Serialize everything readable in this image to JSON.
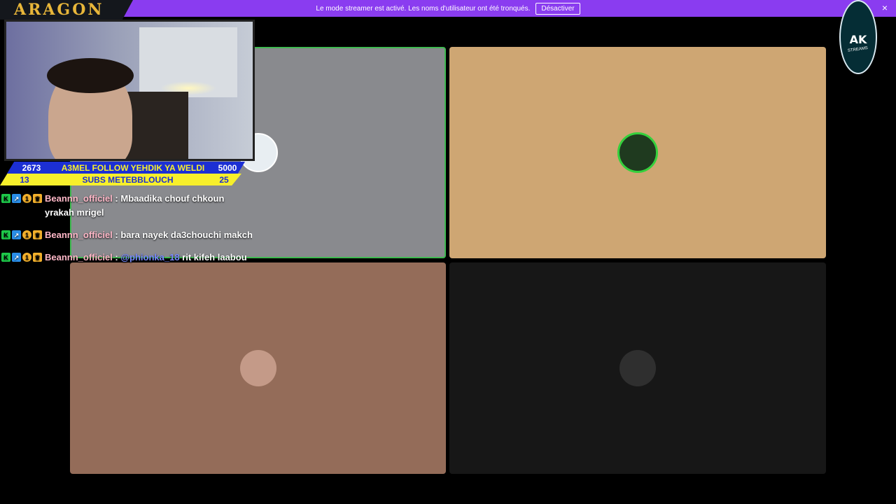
{
  "banner": {
    "message": "Le mode streamer est activé. Les noms d'utilisateur ont été tronqués.",
    "button_label": "Désactiver",
    "close_glyph": "×"
  },
  "logo": {
    "text": "ARAGON"
  },
  "ak_badge": {
    "text": "AK",
    "subtext": "STREAMS"
  },
  "tiles": [
    {
      "bg": "#898a8e",
      "speaking": true,
      "avatar_color": "#e8eef2"
    },
    {
      "bg": "#cea673",
      "speaking": false,
      "avatar_color": "#1f3a1f"
    },
    {
      "bg": "#946c59",
      "speaking": false,
      "avatar_color": "#c49a88"
    },
    {
      "bg": "#171717",
      "speaking": false,
      "avatar_color": "#2f2f2f"
    }
  ],
  "stats": {
    "row1": {
      "count": "2673",
      "title": "A3MEL FOLLOW YEHDIK YA WELDI",
      "goal": "5000"
    },
    "row2": {
      "count": "13",
      "title": "SUBS METEBBLOUCH",
      "goal": "25"
    }
  },
  "chat": [
    {
      "user": "Beannn_officiel",
      "sep": " : ",
      "mention": "",
      "text": "Mbaadika chouf chkoun yrakah mrigel"
    },
    {
      "user": "Beannn_officiel",
      "sep": " : ",
      "mention": "",
      "text": "bara nayek da3chouchi makch"
    },
    {
      "user": "Beannn_officiel",
      "sep": " : ",
      "mention": "@phionka_18",
      "text": " rit kifeh laabou"
    }
  ],
  "badge_icons": [
    "kick-icon",
    "prime-icon",
    "sub-tier-icon",
    "crown-icon"
  ],
  "badge_glyphs": [
    "K",
    "↗",
    "1",
    "♛"
  ]
}
